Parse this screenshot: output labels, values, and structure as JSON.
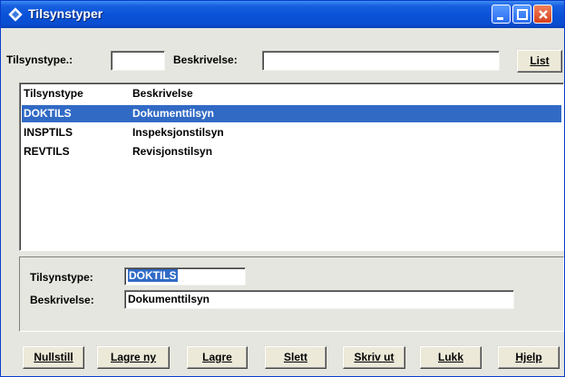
{
  "window": {
    "title": "Tilsynstyper"
  },
  "search": {
    "type_label": "Tilsynstype.:",
    "type_value": "",
    "desc_label": "Beskrivelse:",
    "desc_value": "",
    "list_button": "List"
  },
  "list": {
    "headers": [
      "Tilsynstype",
      "Beskrivelse"
    ],
    "rows": [
      {
        "code": "DOKTILS",
        "desc": "Dokumenttilsyn",
        "selected": true
      },
      {
        "code": "INSPTILS",
        "desc": "Inspeksjonstilsyn",
        "selected": false
      },
      {
        "code": "REVTILS",
        "desc": "Revisjonstilsyn",
        "selected": false
      }
    ]
  },
  "detail": {
    "type_label": "Tilsynstype:",
    "type_value": "DOKTILS",
    "desc_label": "Beskrivelse:",
    "desc_value": "Dokumenttilsyn"
  },
  "buttons": {
    "reset": "Nullstill",
    "save_new": "Lagre ny",
    "save": "Lagre",
    "delete": "Slett",
    "print": "Skriv ut",
    "close": "Lukk",
    "help": "Hjelp"
  },
  "colors": {
    "titlebar": "#0a52d8",
    "selection": "#316ac5",
    "window_bg": "#e6e6e0"
  },
  "icons": {
    "app": "tilsyn-app-icon",
    "minimize": "minimize-icon",
    "maximize": "maximize-icon",
    "close": "close-icon"
  }
}
